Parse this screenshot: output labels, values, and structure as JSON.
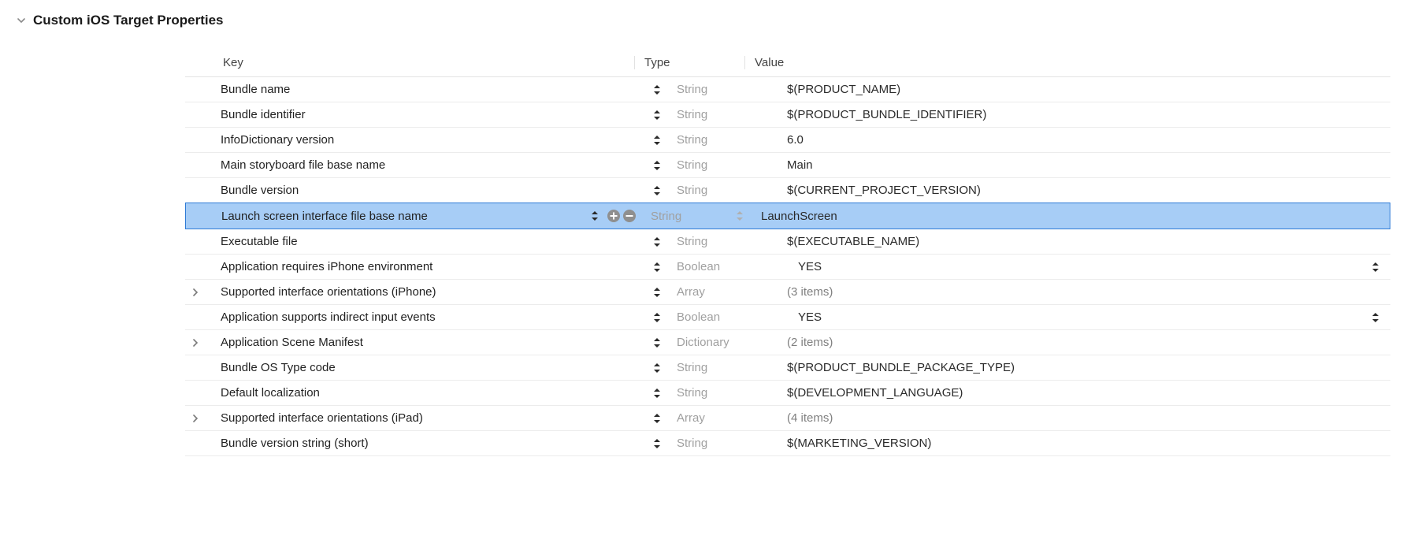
{
  "section": {
    "title": "Custom iOS Target Properties"
  },
  "headers": {
    "key": "Key",
    "type": "Type",
    "value": "Value"
  },
  "rows": [
    {
      "key": "Bundle name",
      "type": "String",
      "value": "$(PRODUCT_NAME)",
      "expandable": false,
      "selected": false,
      "valueMuted": false,
      "valueIndent": false,
      "valueSort": false,
      "typeSortLight": false
    },
    {
      "key": "Bundle identifier",
      "type": "String",
      "value": "$(PRODUCT_BUNDLE_IDENTIFIER)",
      "expandable": false,
      "selected": false,
      "valueMuted": false,
      "valueIndent": false,
      "valueSort": false,
      "typeSortLight": false
    },
    {
      "key": "InfoDictionary version",
      "type": "String",
      "value": "6.0",
      "expandable": false,
      "selected": false,
      "valueMuted": false,
      "valueIndent": false,
      "valueSort": false,
      "typeSortLight": false
    },
    {
      "key": "Main storyboard file base name",
      "type": "String",
      "value": "Main",
      "expandable": false,
      "selected": false,
      "valueMuted": false,
      "valueIndent": false,
      "valueSort": false,
      "typeSortLight": false
    },
    {
      "key": "Bundle version",
      "type": "String",
      "value": "$(CURRENT_PROJECT_VERSION)",
      "expandable": false,
      "selected": false,
      "valueMuted": false,
      "valueIndent": false,
      "valueSort": false,
      "typeSortLight": false
    },
    {
      "key": "Launch screen interface file base name",
      "type": "String",
      "value": "LaunchScreen",
      "expandable": false,
      "selected": true,
      "valueMuted": false,
      "valueIndent": false,
      "valueSort": false,
      "typeSortLight": true
    },
    {
      "key": "Executable file",
      "type": "String",
      "value": "$(EXECUTABLE_NAME)",
      "expandable": false,
      "selected": false,
      "valueMuted": false,
      "valueIndent": false,
      "valueSort": false,
      "typeSortLight": false
    },
    {
      "key": "Application requires iPhone environment",
      "type": "Boolean",
      "value": "YES",
      "expandable": false,
      "selected": false,
      "valueMuted": false,
      "valueIndent": true,
      "valueSort": true,
      "typeSortLight": false
    },
    {
      "key": "Supported interface orientations (iPhone)",
      "type": "Array",
      "value": "(3 items)",
      "expandable": true,
      "selected": false,
      "valueMuted": true,
      "valueIndent": false,
      "valueSort": false,
      "typeSortLight": false
    },
    {
      "key": "Application supports indirect input events",
      "type": "Boolean",
      "value": "YES",
      "expandable": false,
      "selected": false,
      "valueMuted": false,
      "valueIndent": true,
      "valueSort": true,
      "typeSortLight": false
    },
    {
      "key": "Application Scene Manifest",
      "type": "Dictionary",
      "value": "(2 items)",
      "expandable": true,
      "selected": false,
      "valueMuted": true,
      "valueIndent": false,
      "valueSort": false,
      "typeSortLight": false
    },
    {
      "key": "Bundle OS Type code",
      "type": "String",
      "value": "$(PRODUCT_BUNDLE_PACKAGE_TYPE)",
      "expandable": false,
      "selected": false,
      "valueMuted": false,
      "valueIndent": false,
      "valueSort": false,
      "typeSortLight": false
    },
    {
      "key": "Default localization",
      "type": "String",
      "value": "$(DEVELOPMENT_LANGUAGE)",
      "expandable": false,
      "selected": false,
      "valueMuted": false,
      "valueIndent": false,
      "valueSort": false,
      "typeSortLight": false
    },
    {
      "key": "Supported interface orientations (iPad)",
      "type": "Array",
      "value": "(4 items)",
      "expandable": true,
      "selected": false,
      "valueMuted": true,
      "valueIndent": false,
      "valueSort": false,
      "typeSortLight": false
    },
    {
      "key": "Bundle version string (short)",
      "type": "String",
      "value": "$(MARKETING_VERSION)",
      "expandable": false,
      "selected": false,
      "valueMuted": false,
      "valueIndent": false,
      "valueSort": false,
      "typeSortLight": false
    }
  ]
}
